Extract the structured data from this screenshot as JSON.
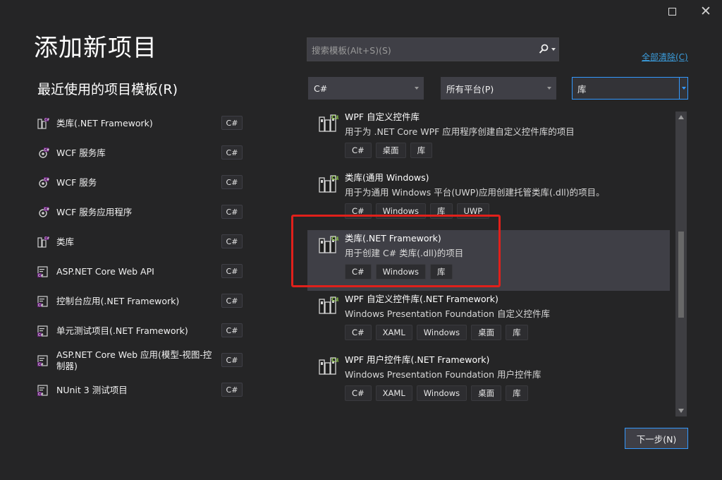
{
  "window": {
    "maximize_label": "",
    "close_label": "✕"
  },
  "header": {
    "title": "添加新项目",
    "recent_title": "最近使用的项目模板(R)"
  },
  "search": {
    "placeholder": "搜索模板(Alt+S)(S)",
    "value": "",
    "clear_all": "全部清除(C)"
  },
  "filters": {
    "language": "C#",
    "platform": "所有平台(P)",
    "project_type": "库"
  },
  "recent": {
    "items": [
      {
        "label": "类库(.NET Framework)",
        "tag": "C#",
        "icon": "class-library-icon"
      },
      {
        "label": "WCF 服务库",
        "tag": "C#",
        "icon": "wcf-service-library-icon"
      },
      {
        "label": "WCF 服务",
        "tag": "C#",
        "icon": "wcf-service-icon"
      },
      {
        "label": "WCF 服务应用程序",
        "tag": "C#",
        "icon": "wcf-service-app-icon"
      },
      {
        "label": "类库",
        "tag": "C#",
        "icon": "class-library-icon"
      },
      {
        "label": "ASP.NET Core Web API",
        "tag": "C#",
        "icon": "web-api-icon"
      },
      {
        "label": "控制台应用(.NET Framework)",
        "tag": "C#",
        "icon": "console-app-icon"
      },
      {
        "label": "单元测试项目(.NET Framework)",
        "tag": "C#",
        "icon": "unit-test-icon"
      },
      {
        "label": "ASP.NET Core Web 应用(模型-视图-控制器)",
        "tag": "C#",
        "icon": "mvc-app-icon"
      },
      {
        "label": "NUnit 3 测试项目",
        "tag": "C#",
        "icon": "nunit-test-icon"
      }
    ]
  },
  "templates": [
    {
      "name": "WPF 自定义控件库",
      "desc": "用于为 .NET Core WPF 应用程序创建自定义控件库的项目",
      "tags": [
        "C#",
        "桌面",
        "库"
      ],
      "icon": "wpf-control-library-icon",
      "selected": false
    },
    {
      "name": "类库(通用 Windows)",
      "desc": "用于为通用 Windows 平台(UWP)应用创建托管类库(.dll)的项目。",
      "tags": [
        "C#",
        "Windows",
        "库",
        "UWP"
      ],
      "icon": "uwp-class-library-icon",
      "selected": false
    },
    {
      "name": "类库(.NET Framework)",
      "desc": "用于创建 C# 类库(.dll)的项目",
      "tags": [
        "C#",
        "Windows",
        "库"
      ],
      "icon": "class-library-icon",
      "selected": true
    },
    {
      "name": "WPF 自定义控件库(.NET Framework)",
      "desc": "Windows Presentation Foundation 自定义控件库",
      "tags": [
        "C#",
        "XAML",
        "Windows",
        "桌面",
        "库"
      ],
      "icon": "wpf-control-library-icon",
      "selected": false
    },
    {
      "name": "WPF 用户控件库(.NET Framework)",
      "desc": "Windows Presentation Foundation 用户控件库",
      "tags": [
        "C#",
        "XAML",
        "Windows",
        "桌面",
        "库"
      ],
      "icon": "wpf-user-control-library-icon",
      "selected": false
    }
  ],
  "scroll": {
    "position_fraction": 0.4
  },
  "footer": {
    "next_label": "下一步(N)"
  },
  "colors": {
    "accent": "#3399ff",
    "link": "#3b9ddd",
    "highlight": "#e0201b",
    "background": "#252526"
  }
}
